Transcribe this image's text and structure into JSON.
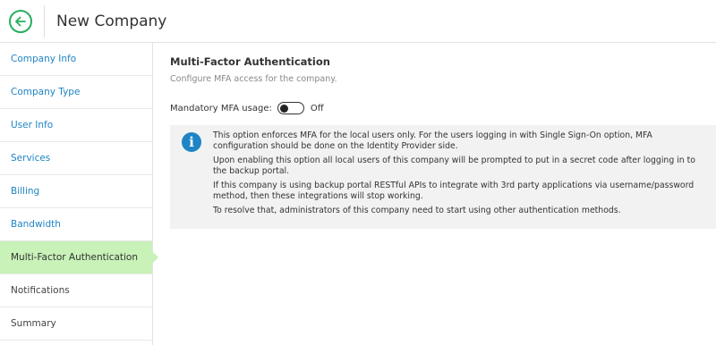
{
  "header": {
    "title": "New Company",
    "back_icon": "arrow-left-circle-icon",
    "accent_color": "#27ae60"
  },
  "sidebar": {
    "items": [
      {
        "label": "Company Info"
      },
      {
        "label": "Company Type"
      },
      {
        "label": "User Info"
      },
      {
        "label": "Services"
      },
      {
        "label": "Billing"
      },
      {
        "label": "Bandwidth"
      },
      {
        "label": "Multi-Factor Authentication",
        "active": true
      },
      {
        "label": "Notifications"
      },
      {
        "label": "Summary"
      }
    ],
    "active_color": "#c8f2b8",
    "link_color": "#1f84c4"
  },
  "main": {
    "title": "Multi-Factor Authentication",
    "description": "Configure MFA access for the company.",
    "mfa_toggle": {
      "label": "Mandatory MFA usage:",
      "state_text": "Off",
      "on": false
    },
    "info": {
      "icon": "info-icon",
      "paragraphs": [
        "This option enforces MFA for the local users only. For the users logging in with Single Sign-On option, MFA configuration should be done on the Identity Provider side.",
        "Upon enabling this option all local users of this company will be prompted to put in a secret code after logging in to the backup portal.",
        "If this company is using backup portal RESTful APIs to integrate with 3rd party applications via username/password method, then these integrations will stop working.",
        "To resolve that, administrators of this company need to start using other authentication methods."
      ]
    }
  }
}
